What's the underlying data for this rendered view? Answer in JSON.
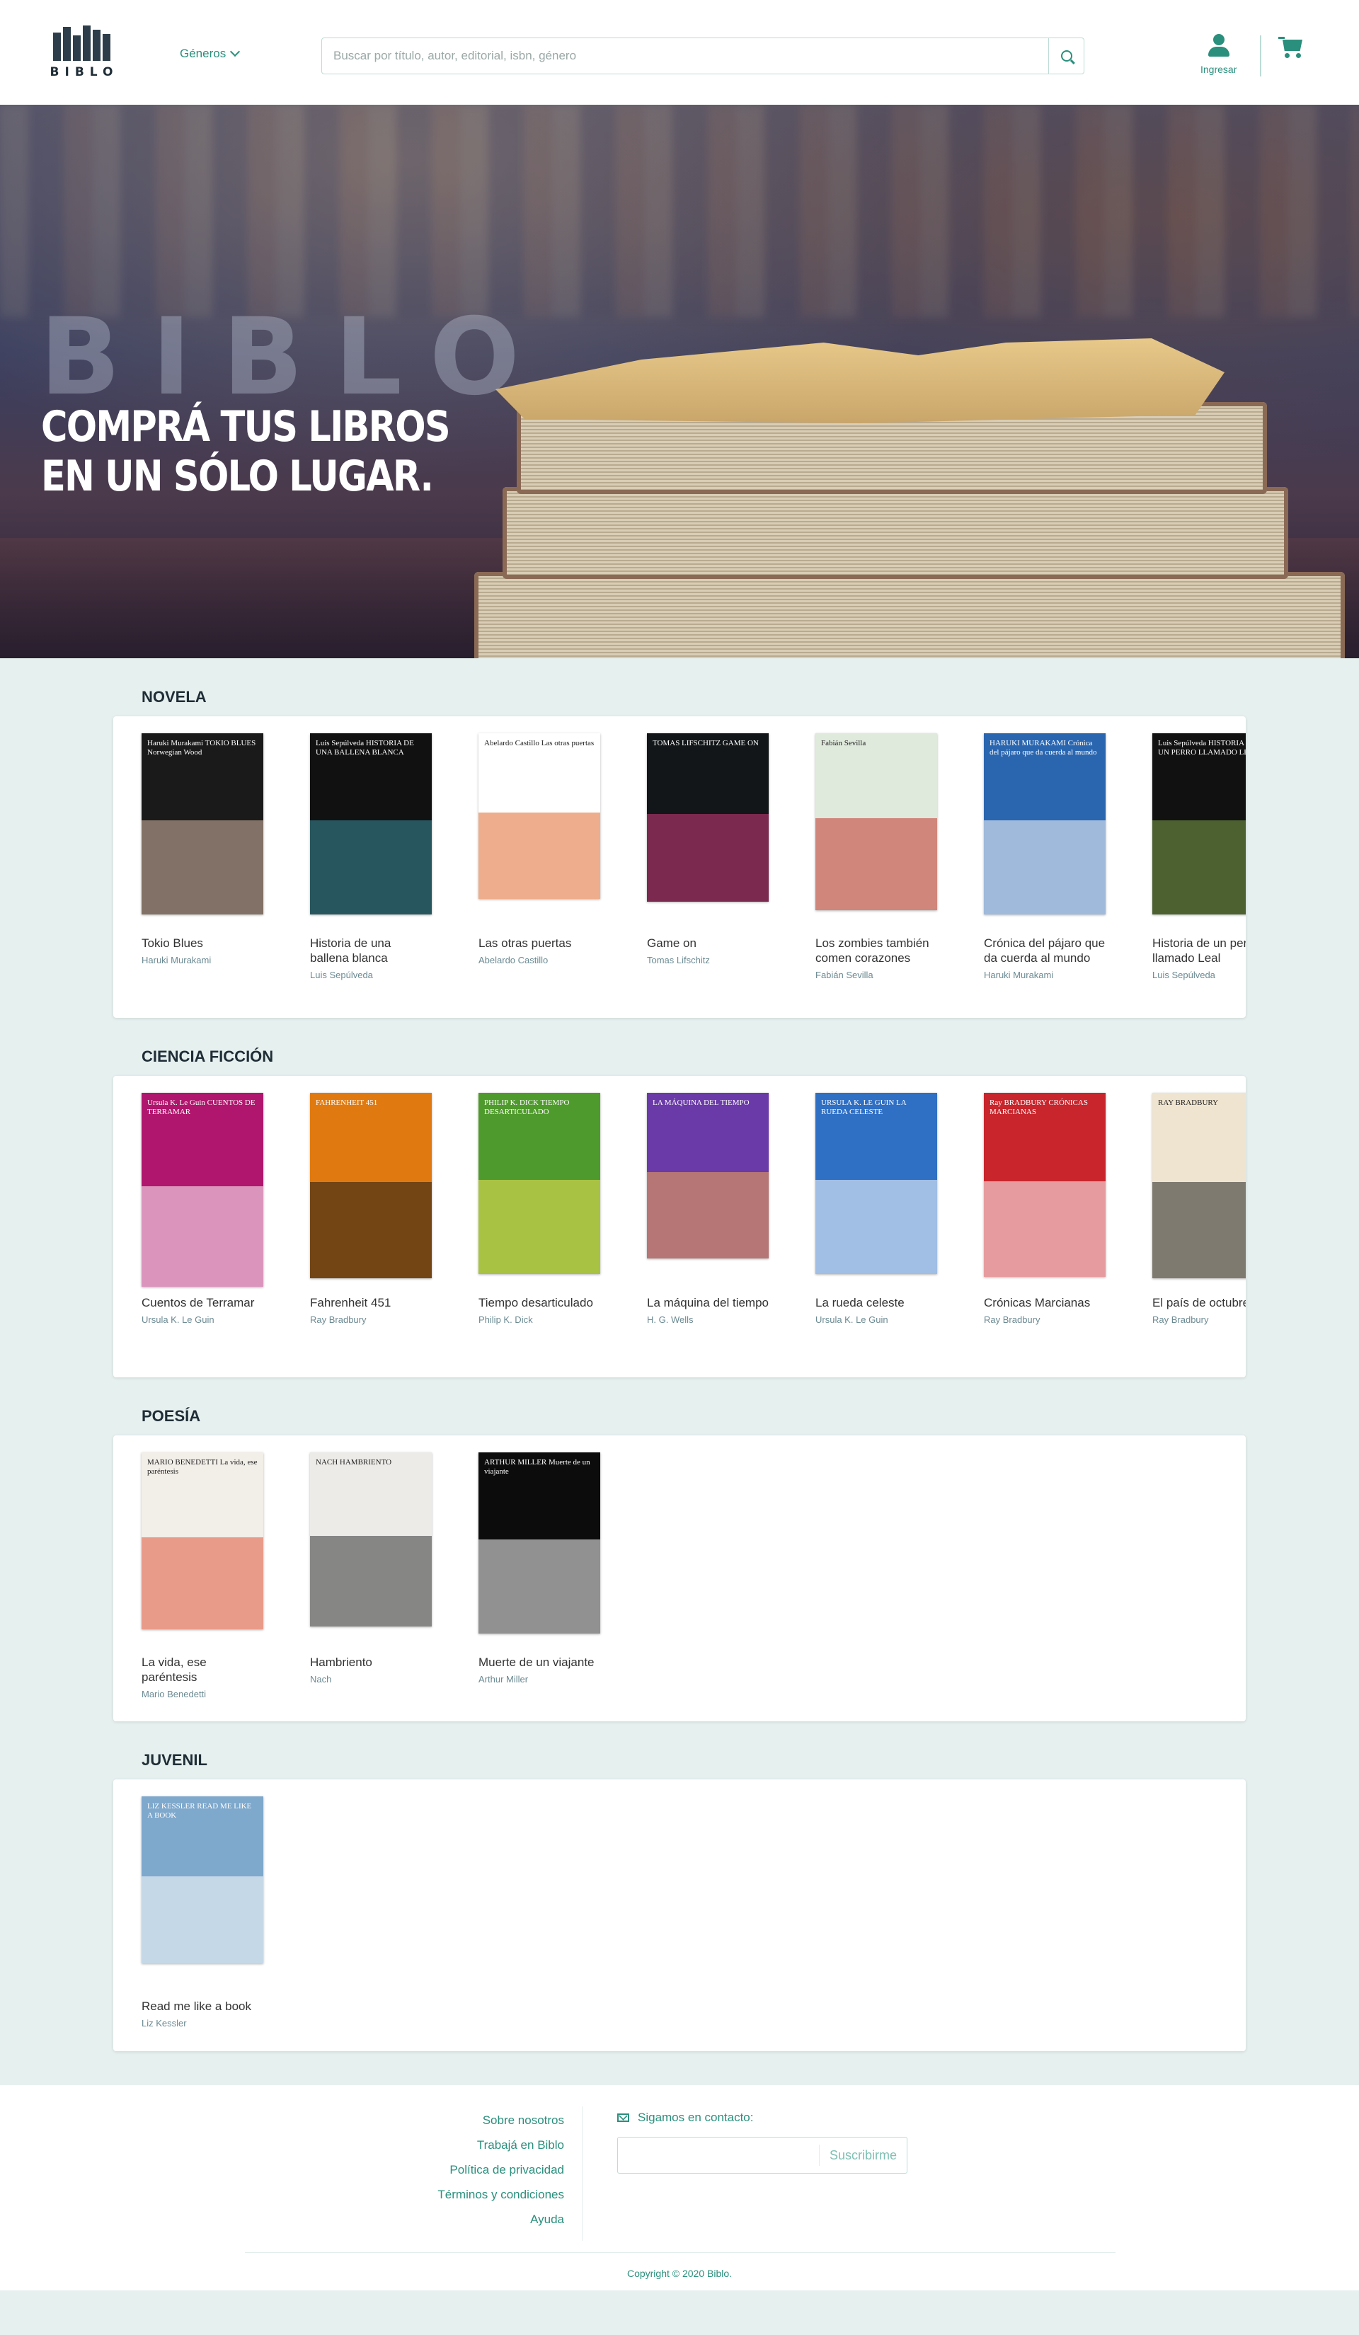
{
  "header": {
    "logo_text": "BIBLO",
    "genres_label": "Géneros",
    "search_placeholder": "Buscar por título, autor, editorial, isbn, género",
    "login_label": "Ingresar"
  },
  "hero": {
    "brand": "BIBLO",
    "line1": "COMPRÁ TUS LIBROS",
    "line2": "EN UN SÓLO LUGAR."
  },
  "sections": [
    {
      "title": "NOVELA",
      "books": [
        {
          "title": "Tokio Blues",
          "author": "Haruki Murakami",
          "cover_text": "Haruki Murakami TOKIO BLUES Norwegian Wood",
          "cover_bg": "#1a1a1a",
          "cover_fg": "#d8b9a6",
          "cover_h": 256
        },
        {
          "title": "Historia de una ballena blanca",
          "author": "Luis Sepúlveda",
          "cover_text": "Luis Sepúlveda HISTORIA DE UNA BALLENA BLANCA",
          "cover_bg": "#111",
          "cover_fg": "#3a8f9f",
          "cover_h": 256
        },
        {
          "title": "Las otras puertas",
          "author": "Abelardo Castillo",
          "cover_text": "Abelardo Castillo Las otras puertas",
          "cover_bg": "#fff",
          "cover_fg": "#e06a2d",
          "cover_h": 234
        },
        {
          "title": "Game on",
          "author": "Tomas Lifschitz",
          "cover_text": "TOMAS LIFSCHITZ GAME ON",
          "cover_bg": "#121618",
          "cover_fg": "#d23a7e",
          "cover_h": 238
        },
        {
          "title": "Los zombies también comen corazones",
          "author": "Fabián Sevilla",
          "cover_text": "Fabián Sevilla",
          "cover_bg": "#dfe9dc",
          "cover_fg": "#c2352b",
          "cover_h": 250
        },
        {
          "title": "Crónica del pájaro que da cuerda al mundo",
          "author": "Haruki Murakami",
          "cover_text": "HARUKI MURAKAMI Crónica del pájaro que da cuerda al mundo",
          "cover_bg": "#2a66b0",
          "cover_fg": "#ffffff",
          "cover_h": 256
        },
        {
          "title": "Historia de un perro llamado Leal",
          "author": "Luis Sepúlveda",
          "cover_text": "Luis Sepúlveda HISTORIA DE UN PERRO LLAMADO LEAL",
          "cover_bg": "#111",
          "cover_fg": "#7da24a",
          "cover_h": 256
        }
      ]
    },
    {
      "title": "CIENCIA FICCIÓN",
      "books": [
        {
          "title": "Cuentos de Terramar",
          "author": "Ursula K. Le Guin",
          "cover_text": "Ursula K. Le Guin CUENTOS DE TERRAMAR",
          "cover_bg": "#b0166d",
          "cover_fg": "#ffffff",
          "cover_h": 274
        },
        {
          "title": "Fahrenheit 451",
          "author": "Ray Bradbury",
          "cover_text": "FAHRENHEIT 451",
          "cover_bg": "#e07a10",
          "cover_fg": "#1a1a1a",
          "cover_h": 262
        },
        {
          "title": "Tiempo desarticulado",
          "author": "Philip K. Dick",
          "cover_text": "PHILIP K. DICK TIEMPO DESARTICULADO",
          "cover_bg": "#4f9a2c",
          "cover_fg": "#f2e35a",
          "cover_h": 256
        },
        {
          "title": "La máquina del tiempo",
          "author": "H. G. Wells",
          "cover_text": "LA MÁQUINA DEL TIEMPO",
          "cover_bg": "#6a3aa8",
          "cover_fg": "#f3a84a",
          "cover_h": 234
        },
        {
          "title": "La rueda celeste",
          "author": "Ursula K. Le Guin",
          "cover_text": "URSULA K. LE GUIN LA RUEDA CELESTE",
          "cover_bg": "#2f6fc4",
          "cover_fg": "#ffffff",
          "cover_h": 256
        },
        {
          "title": "Crónicas Marcianas",
          "author": "Ray Bradbury",
          "cover_text": "Ray BRADBURY CRÓNICAS MARCIANAS",
          "cover_bg": "#c8252c",
          "cover_fg": "#ffffff",
          "cover_h": 260
        },
        {
          "title": "El país de octubre",
          "author": "Ray Bradbury",
          "cover_text": "RAY BRADBURY",
          "cover_bg": "#efe4cf",
          "cover_fg": "#222",
          "cover_h": 262
        }
      ]
    },
    {
      "title": "POESÍA",
      "books": [
        {
          "title": "La vida, ese paréntesis",
          "author": "Mario Benedetti",
          "cover_text": "MARIO BENEDETTI La vida, ese paréntesis",
          "cover_bg": "#f2eee8",
          "cover_fg": "#e2573a",
          "cover_h": 250
        },
        {
          "title": "Hambriento",
          "author": "Nach",
          "cover_text": "NACH HAMBRIENTO",
          "cover_bg": "#ecebe8",
          "cover_fg": "#333",
          "cover_h": 246
        },
        {
          "title": "Muerte de un viajante",
          "author": "Arthur Miller",
          "cover_text": "ARTHUR MILLER Muerte de un viajante",
          "cover_bg": "#0c0c0c",
          "cover_fg": "#ffffff",
          "cover_h": 256
        }
      ]
    },
    {
      "title": "JUVENIL",
      "books": [
        {
          "title": "Read me like a book",
          "author": "Liz Kessler",
          "cover_text": "LIZ KESSLER READ ME LIKE A BOOK",
          "cover_bg": "#7ea8cc",
          "cover_fg": "#ffffff",
          "cover_h": 236
        }
      ]
    }
  ],
  "footer": {
    "links": [
      "Sobre nosotros",
      "Trabajá en Biblo",
      "Política de privacidad",
      "Términos y condiciones",
      "Ayuda"
    ],
    "contact_label": "Sigamos en contacto:",
    "subscribe_label": "Suscribirme",
    "copyright": "Copyright © 2020 Biblo."
  },
  "colors": {
    "accent": "#2a8f7c",
    "background": "#e6f0ef"
  },
  "icons": [
    "chevron-down-icon",
    "search-icon",
    "user-icon",
    "cart-icon",
    "envelope-icon"
  ]
}
